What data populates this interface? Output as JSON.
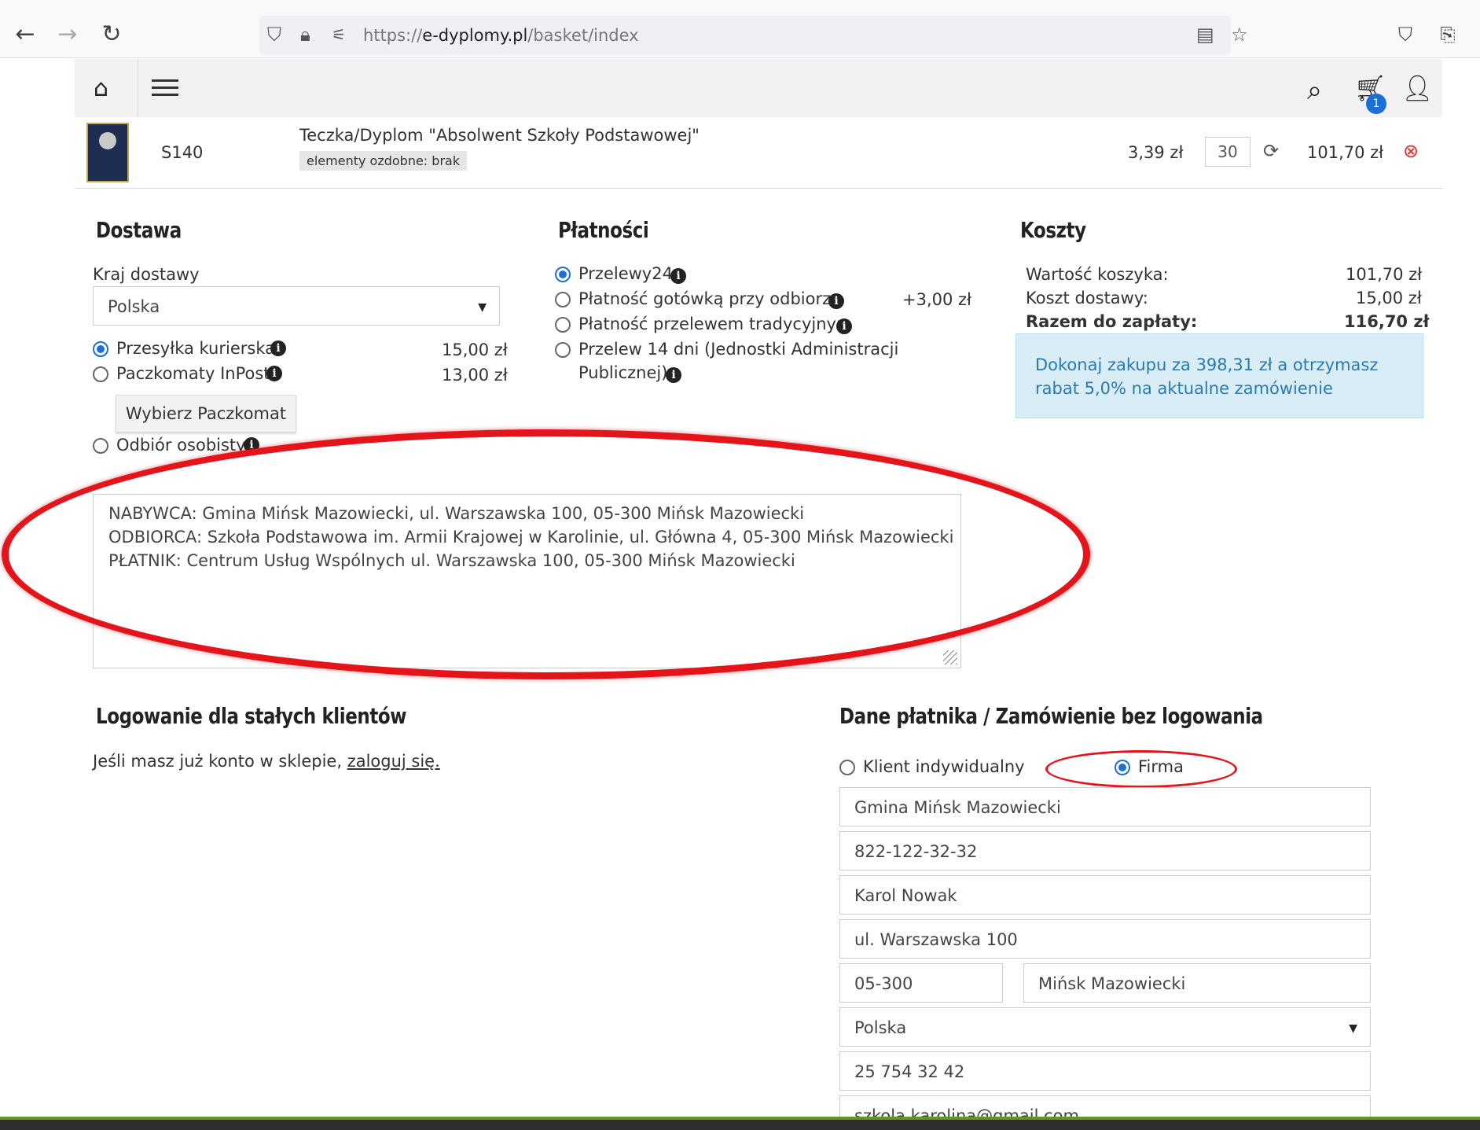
{
  "browser": {
    "url_prefix": "https://",
    "url_domain": "e-dyplomy.pl",
    "url_path": "/basket/index"
  },
  "header": {
    "cart_count": "1"
  },
  "basket": {
    "code": "S140",
    "name": "Teczka/Dyplom \"Absolwent Szkoły Podstawowej\"",
    "tag": "elementy ozdobne: brak",
    "unit_price": "3,39 zł",
    "quantity": "30",
    "total": "101,70 zł"
  },
  "delivery": {
    "heading": "Dostawa",
    "country_label": "Kraj dostawy",
    "country_value": "Polska",
    "options": [
      {
        "label": "Przesyłka kurierska",
        "price": "15,00 zł",
        "checked": true
      },
      {
        "label": "Paczkomaty InPost",
        "price": "13,00 zł",
        "checked": false
      },
      {
        "label": "Odbiór osobisty",
        "price": "",
        "checked": false
      }
    ],
    "paczkomat_button": "Wybierz Paczkomat"
  },
  "payment": {
    "heading": "Płatności",
    "options": [
      {
        "label": "Przelewy24",
        "checked": true
      },
      {
        "label": "Płatność gotówką przy odbiorze",
        "extra": "+3,00 zł",
        "checked": false
      },
      {
        "label": "Płatność przelewem tradycyjnym",
        "checked": false
      },
      {
        "label": "Przelew 14 dni (Jednostki Administracji",
        "label2": "Publicznej)",
        "checked": false
      }
    ]
  },
  "costs": {
    "heading": "Koszty",
    "rows": [
      {
        "label": "Wartość koszyka:",
        "value": "101,70 zł"
      },
      {
        "label": "Koszt dostawy:",
        "value": "15,00 zł"
      },
      {
        "label": "Razem do zapłaty:",
        "value": "116,70 zł"
      }
    ],
    "promo": "Dokonaj zakupu za 398,31 zł a otrzymasz rabat 5,0% na aktualne zamówienie"
  },
  "comments": {
    "lines": [
      "NABYWCA: Gmina Mińsk Mazowiecki, ul. Warszawska 100, 05-300 Mińsk Mazowiecki",
      "ODBIORCA: Szkoła Podstawowa im. Armii Krajowej w Karolinie, ul. Główna 4, 05-300 Mińsk Mazowiecki",
      "PŁATNIK: Centrum Usług Wspólnych ul. Warszawska 100, 05-300 Mińsk Mazowiecki"
    ]
  },
  "login": {
    "heading": "Logowanie dla stałych klientów",
    "text": "Jeśli masz już konto w sklepie, ",
    "link": "zaloguj się."
  },
  "payer": {
    "heading": "Dane płatnika / Zamówienie bez logowania",
    "type_individual": "Klient indywidualny",
    "type_company": "Firma",
    "company": "Gmina Mińsk Mazowiecki",
    "nip": "822-122-32-32",
    "name": "Karol Nowak",
    "street": "ul. Warszawska 100",
    "postcode": "05-300",
    "city": "Mińsk Mazowiecki",
    "country": "Polska",
    "phone": "25 754 32 42",
    "email": "szkola.karolina@gmail.com"
  },
  "colors": {
    "accent": "#1e6ed8",
    "highlight": "#e4141b",
    "info_box": "#d9edf7"
  }
}
